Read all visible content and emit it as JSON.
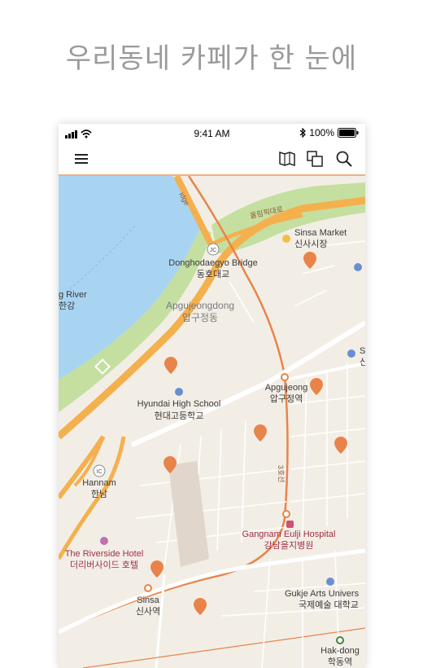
{
  "headline": "우리동네 카페가 한 눈에",
  "status": {
    "time": "9:41 AM",
    "battery": "100%"
  },
  "toolbar": {
    "menu_icon": "hamburger-menu-icon",
    "map_icon": "folded-map-icon",
    "layers_icon": "overlapping-squares-icon",
    "search_icon": "search-icon"
  },
  "colors": {
    "accent": "#f0b080",
    "pin": "#e8844a",
    "water": "#a8d4f2",
    "park": "#c4dfa0",
    "road_major": "#f5b04e",
    "land": "#f2eee6"
  },
  "map": {
    "labels": {
      "olympic": "올림픽대로",
      "bridge_top": "idge",
      "sinsa_market_en": "Sinsa Market",
      "sinsa_market_ko": "신사시장",
      "jc": "JC",
      "dongho_en": "Donghodaegyo Bridge",
      "dongho_ko": "동호대교",
      "han_river_en": "g River",
      "han_river_ko": "한강",
      "apgujeongdong_en": "Apgujeongdong",
      "apgujeongdong_ko": "압구정동",
      "apgujeong_en": "Apgujeong",
      "apgujeong_ko": "압구정역",
      "hyundai_en": "Hyundai High School",
      "hyundai_ko": "현대고등학교",
      "ic": "IC",
      "hannam_en": "Hannam",
      "hannam_ko": "한남",
      "route3": "3호선",
      "gangnam_en": "Gangnam Eulji Hospital",
      "gangnam_ko": "강남을지병원",
      "riverside_en": "The Riverside Hotel",
      "riverside_ko": "더리버사이드 호텔",
      "sinsa_en": "Sinsa",
      "sinsa_ko": "신사역",
      "gukje_en": "Gukje Arts Univers",
      "gukje_ko": "국제예술 대학교",
      "hakdong_en": "Hak-dong",
      "hakdong_ko": "학동역",
      "edge_s": "S",
      "edge_sin": "신"
    }
  }
}
